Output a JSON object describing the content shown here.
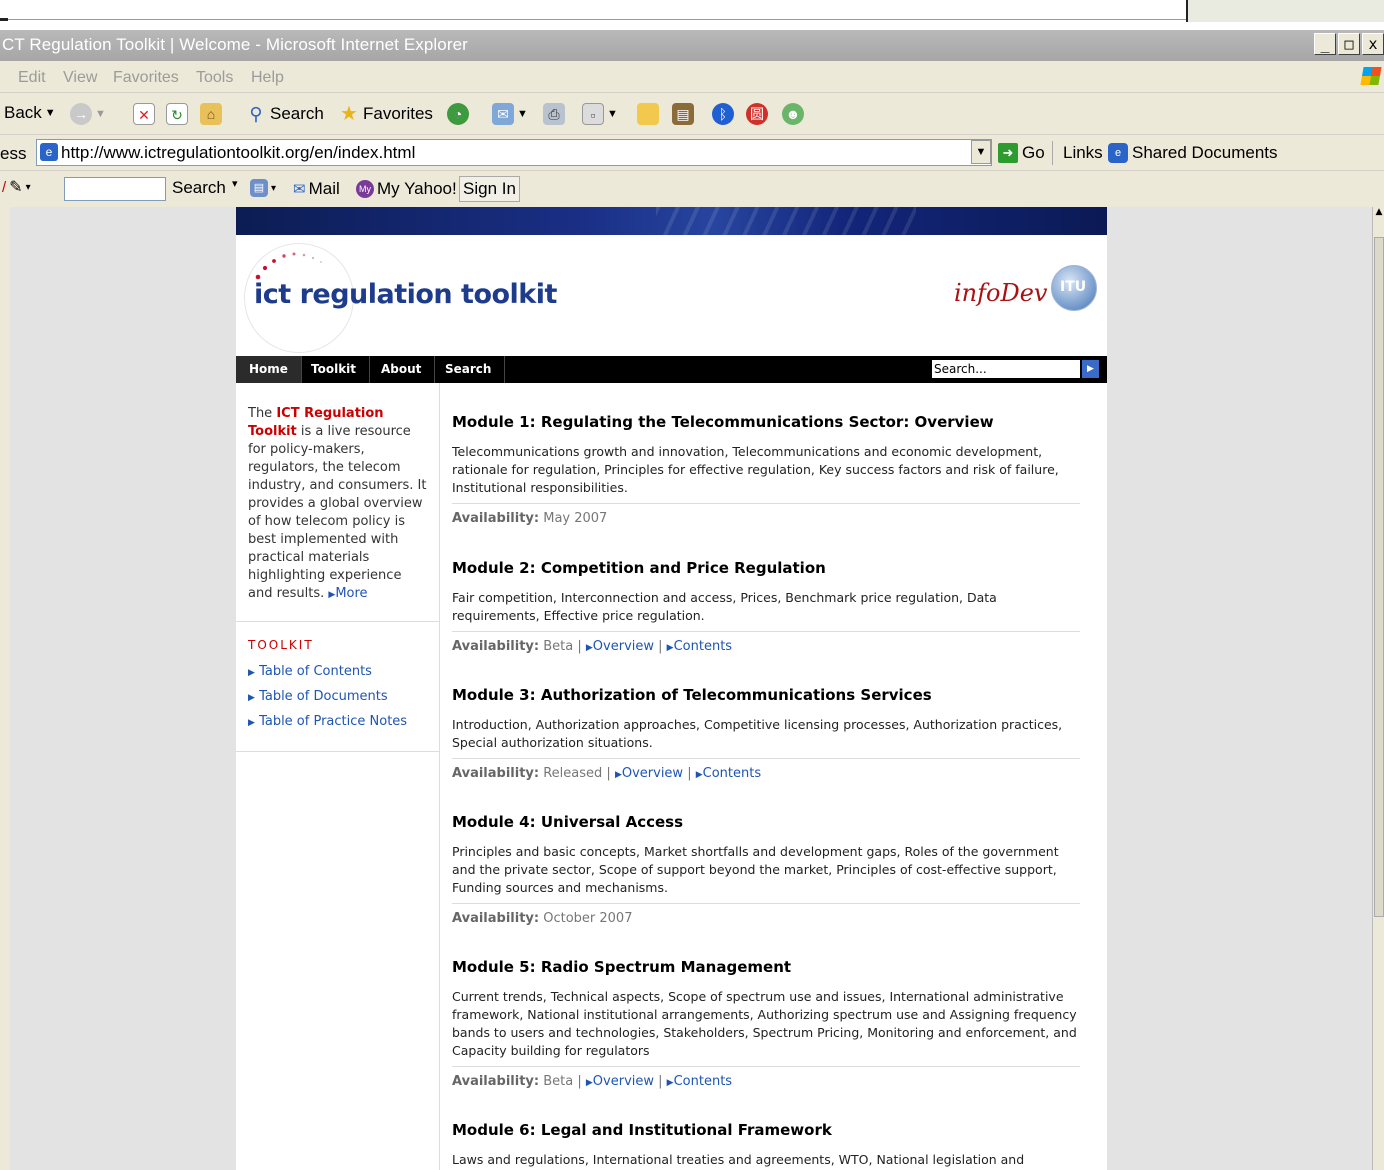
{
  "window": {
    "title": "CT Regulation Toolkit | Welcome - Microsoft Internet Explorer",
    "buttons": [
      "_",
      "□",
      "x"
    ]
  },
  "menu": [
    "Edit",
    "View",
    "Favorites",
    "Tools",
    "Help"
  ],
  "toolbar": {
    "back": "Back",
    "search": "Search",
    "favorites": "Favorites"
  },
  "address": {
    "label": "ess",
    "url": "http://www.ictregulationtoolkit.org/en/index.html",
    "go": "Go",
    "links": "Links",
    "shared": "Shared Documents"
  },
  "yahoo": {
    "search": "Search",
    "mail": "Mail",
    "my_yahoo": "My Yahoo!",
    "sign_in": "Sign In"
  },
  "site": {
    "logo": "ict regulation toolkit",
    "partner": "infoDev",
    "itu": "ITU",
    "nav": [
      "Home",
      "Toolkit",
      "About",
      "Search"
    ],
    "search_placeholder": "Search...",
    "intro_pre": "The ",
    "intro_name": "ICT Regulation Toolkit",
    "intro_post": " is a live resource for policy-makers, regulators, the telecom industry, and consumers. It provides a global overview of how telecom policy is best implemented with practical materials highlighting experience and results. ",
    "more": "More",
    "toolkit_heading": "TOOLKIT",
    "toolkit_links": [
      "Table of Contents",
      "Table of Documents",
      "Table of Practice Notes"
    ],
    "modules": [
      {
        "title": "Module 1: Regulating the Telecommunications Sector: Overview",
        "desc": "Telecommunications growth and innovation, Telecommunications and economic development, rationale for regulation, Principles for effective regulation, Key success factors and risk of failure, Institutional responsibilities.",
        "availability_label": "Availability:",
        "availability": "May 2007",
        "links": []
      },
      {
        "title": "Module 2: Competition and Price Regulation",
        "desc": "Fair competition, Interconnection and access, Prices, Benchmark price regulation, Data requirements, Effective price regulation.",
        "availability_label": "Availability:",
        "availability": "Beta",
        "links": [
          "Overview",
          "Contents"
        ]
      },
      {
        "title": "Module 3: Authorization of Telecommunications Services",
        "desc": "Introduction, Authorization approaches, Competitive licensing processes, Authorization practices, Special authorization situations.",
        "availability_label": "Availability:",
        "availability": "Released",
        "links": [
          "Overview",
          "Contents"
        ]
      },
      {
        "title": "Module 4: Universal Access",
        "desc": "Principles and basic concepts, Market shortfalls and development gaps, Roles of the government and the private sector, Scope of support beyond the market, Principles of cost-effective support, Funding sources and mechanisms.",
        "availability_label": "Availability:",
        "availability": "October 2007",
        "links": []
      },
      {
        "title": "Module 5: Radio Spectrum Management",
        "desc": "Current trends, Technical aspects, Scope of spectrum use and issues, International administrative framework, National institutional arrangements, Authorizing spectrum use and Assigning frequency bands to users and technologies, Stakeholders, Spectrum Pricing, Monitoring and enforcement, and Capacity building for regulators",
        "availability_label": "Availability:",
        "availability": "Beta",
        "links": [
          "Overview",
          "Contents"
        ]
      },
      {
        "title": "Module 6: Legal and Institutional Framework",
        "desc": "Laws and regulations, International treaties and agreements, WTO, National legislation and",
        "availability_label": "",
        "availability": "",
        "links": []
      }
    ]
  }
}
